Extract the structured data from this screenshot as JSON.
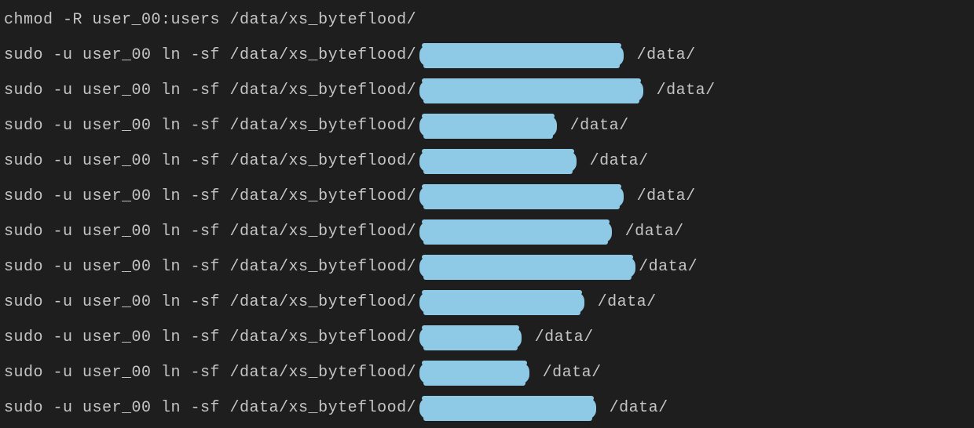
{
  "terminal": {
    "lines": [
      {
        "type": "plain",
        "text": "chmod -R user_00:users /data/xs_byteflood/"
      },
      {
        "type": "redacted",
        "prefix": "sudo -u user_00 ln -sf /data/xs_byteflood/",
        "suffix": " /data/",
        "redactionWidth": 260
      },
      {
        "type": "redacted",
        "prefix": "sudo -u user_00 ln -sf /data/xs_byteflood/",
        "suffix": " /data/",
        "redactionWidth": 285
      },
      {
        "type": "redacted",
        "prefix": "sudo -u user_00 ln -sf /data/xs_byteflood/",
        "suffix": " /data/",
        "redactionWidth": 175
      },
      {
        "type": "redacted",
        "prefix": "sudo -u user_00 ln -sf /data/xs_byteflood/",
        "suffix": " /data/",
        "redactionWidth": 200
      },
      {
        "type": "redacted",
        "prefix": "sudo -u user_00 ln -sf /data/xs_byteflood/",
        "suffix": " /data/",
        "redactionWidth": 260
      },
      {
        "type": "redacted",
        "prefix": "sudo -u user_00 ln -sf /data/xs_byteflood/",
        "suffix": " /data/",
        "redactionWidth": 245
      },
      {
        "type": "redacted",
        "prefix": "sudo -u user_00 ln -sf /data/xs_byteflood/",
        "suffix": "/data/",
        "redactionWidth": 275
      },
      {
        "type": "redacted",
        "prefix": "sudo -u user_00 ln -sf /data/xs_byteflood/",
        "suffix": " /data/",
        "redactionWidth": 210
      },
      {
        "type": "redacted",
        "prefix": "sudo -u user_00 ln -sf /data/xs_byteflood/",
        "suffix": " /data/",
        "redactionWidth": 130
      },
      {
        "type": "redacted",
        "prefix": "sudo -u user_00 ln -sf /data/xs_byteflood/",
        "suffix": " /data/",
        "redactionWidth": 140
      },
      {
        "type": "redacted",
        "prefix": "sudo -u user_00 ln -sf /data/xs_byteflood/",
        "suffix": " /data/",
        "redactionWidth": 225
      }
    ]
  }
}
